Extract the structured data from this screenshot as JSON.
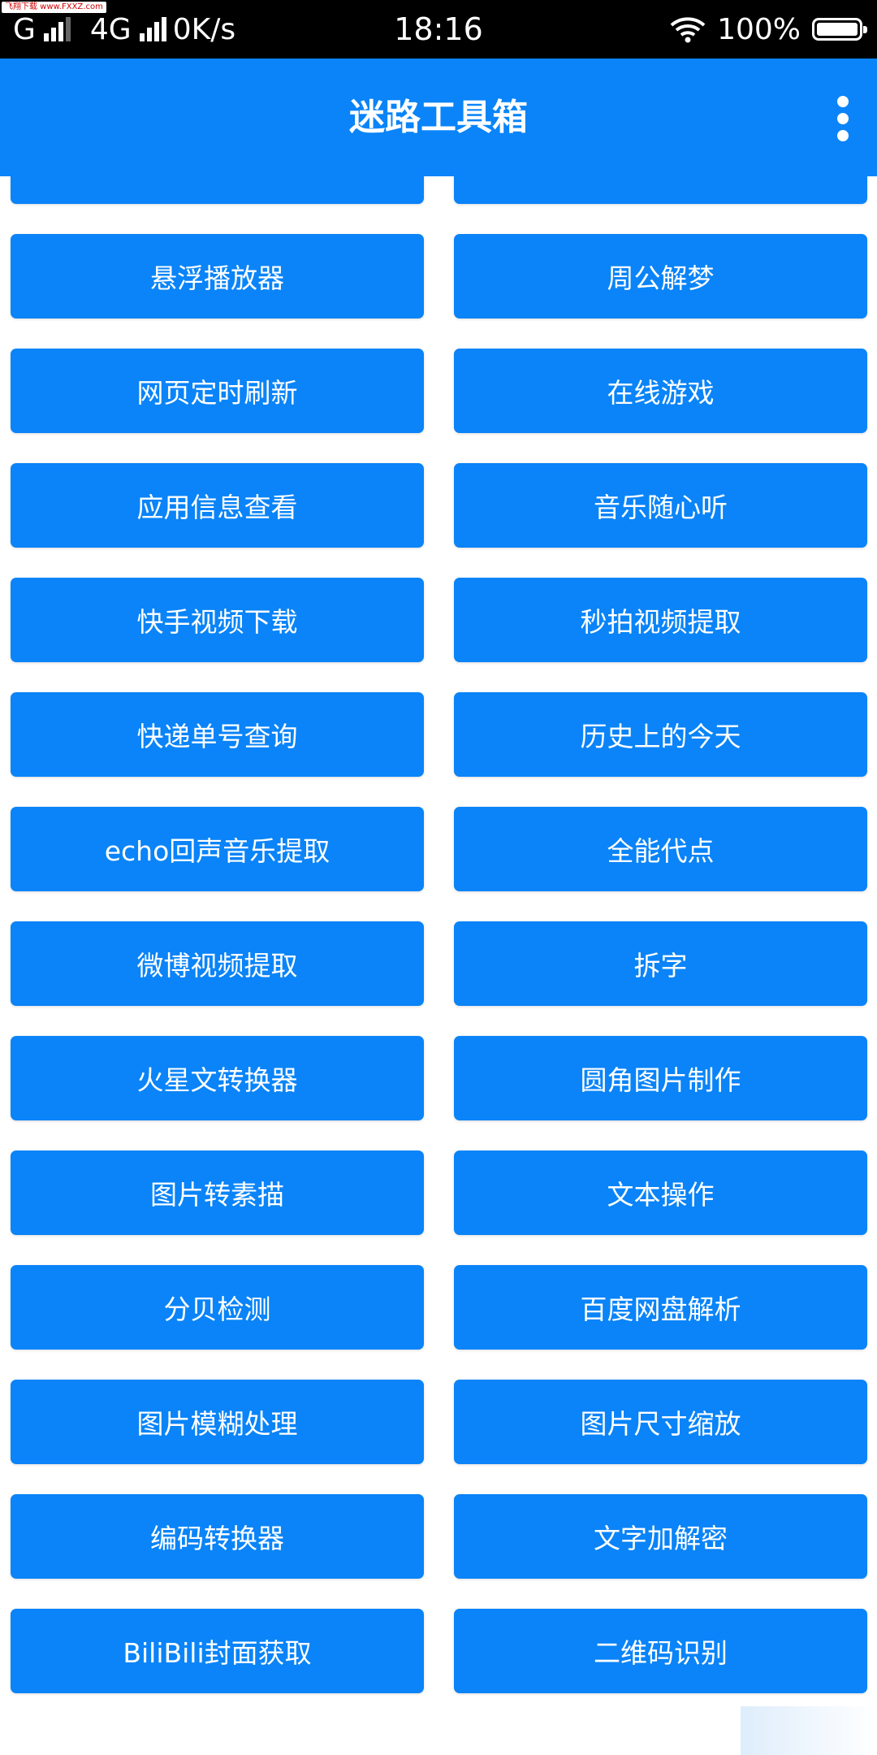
{
  "status_bar": {
    "watermark": "飞翔下载 www.FXXZ.com",
    "carrier1": "G",
    "carrier2": "4G",
    "speed": "0K/s",
    "time": "18:16",
    "battery": "100%"
  },
  "app_bar": {
    "title": "迷路工具箱",
    "menu_icon": "more-vert-icon"
  },
  "tools": [
    "",
    "",
    "悬浮播放器",
    "周公解梦",
    "网页定时刷新",
    "在线游戏",
    "应用信息查看",
    "音乐随心听",
    "快手视频下载",
    "秒拍视频提取",
    "快递单号查询",
    "历史上的今天",
    "echo回声音乐提取",
    "全能代点",
    "微博视频提取",
    "拆字",
    "火星文转换器",
    "圆角图片制作",
    "图片转素描",
    "文本操作",
    "分贝检测",
    "百度网盘解析",
    "图片模糊处理",
    "图片尺寸缩放",
    "编码转换器",
    "文字加解密",
    "BiliBili封面获取",
    "二维码识别"
  ],
  "colors": {
    "accent": "#0a84f8",
    "status_bar": "#000000"
  }
}
